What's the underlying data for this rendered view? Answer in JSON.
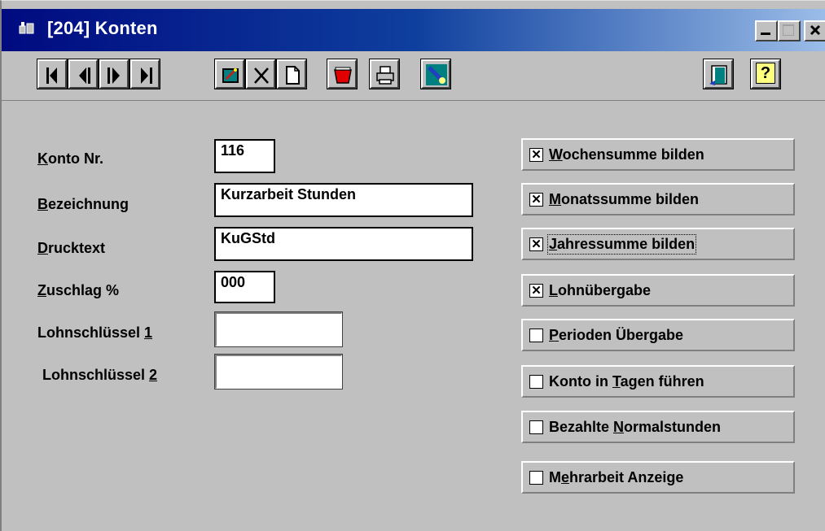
{
  "window": {
    "title": "[204] Konten",
    "controls": {
      "minimize": "_",
      "maximize": "□",
      "close": "×"
    }
  },
  "toolbar": {
    "nav": [
      "first",
      "previous",
      "next",
      "last"
    ],
    "tools": [
      "edit-icon",
      "delete-icon",
      "new-document-icon",
      "basket-icon",
      "print-icon",
      "search-icon"
    ],
    "right": [
      "exit-door-icon",
      "help-icon"
    ],
    "help_label": "?"
  },
  "form": {
    "konto_nr": {
      "label_u": "K",
      "label_rest": "onto Nr.",
      "value": "116"
    },
    "bezeichnung": {
      "label_u": "B",
      "label_rest": "ezeichnung",
      "value": "Kurzarbeit Stunden"
    },
    "drucktext": {
      "label_u": "D",
      "label_rest": "rucktext",
      "value": "KuGStd"
    },
    "zuschlag": {
      "label_u": "Z",
      "label_rest": "uschlag %",
      "value": "000"
    },
    "lohnschluessel1": {
      "label": "Lohnschlüssel ",
      "label_u": "1",
      "value": ""
    },
    "lohnschluessel2": {
      "label": "Lohnschlüssel ",
      "label_u": "2",
      "value": ""
    }
  },
  "options": [
    {
      "pre": "",
      "u": "W",
      "post": "ochensumme bilden",
      "checked": true
    },
    {
      "pre": "",
      "u": "M",
      "post": "onatssumme bilden",
      "checked": true
    },
    {
      "pre": "",
      "u": "J",
      "post": "ahressumme bilden",
      "checked": true
    },
    {
      "pre": "",
      "u": "L",
      "post": "ohnübergabe",
      "checked": true
    },
    {
      "pre": "",
      "u": "P",
      "post": "erioden Übergabe",
      "checked": false
    },
    {
      "pre": "Konto in ",
      "u": "T",
      "post": "agen führen",
      "checked": false
    },
    {
      "pre": "Bezahlte ",
      "u": "N",
      "post": "ormalstunden",
      "checked": false
    },
    {
      "pre": "M",
      "u": "e",
      "post": "hrarbeit Anzeige",
      "checked": false
    }
  ],
  "check_mark": "✕"
}
